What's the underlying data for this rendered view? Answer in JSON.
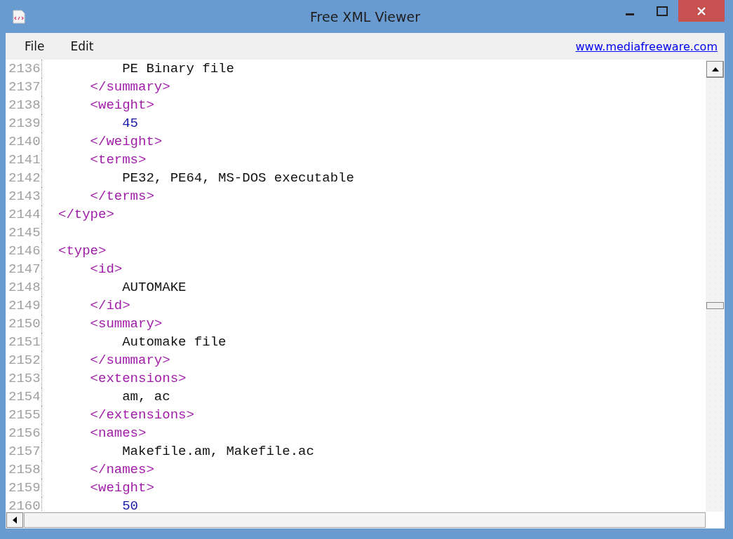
{
  "window": {
    "title": "Free XML Viewer"
  },
  "menu": [
    {
      "label": "File"
    },
    {
      "label": "Edit"
    }
  ],
  "link": "www.mediafreeware.com",
  "lines": [
    {
      "number": "2136",
      "kind": "text",
      "text": "        PE Binary file"
    },
    {
      "number": "2137",
      "kind": "tag",
      "text": "    </summary>"
    },
    {
      "number": "2138",
      "kind": "tag",
      "text": "    <weight>"
    },
    {
      "number": "2139",
      "kind": "number",
      "text": "        45"
    },
    {
      "number": "2140",
      "kind": "tag",
      "text": "    </weight>"
    },
    {
      "number": "2141",
      "kind": "tag",
      "text": "    <terms>"
    },
    {
      "number": "2142",
      "kind": "text",
      "text": "        PE32, PE64, MS-DOS executable"
    },
    {
      "number": "2143",
      "kind": "tag",
      "text": "    </terms>"
    },
    {
      "number": "2144",
      "kind": "tag",
      "text": "</type>"
    },
    {
      "number": "2145",
      "kind": "blank"
    },
    {
      "number": "2146",
      "kind": "tag",
      "text": "<type>"
    },
    {
      "number": "2147",
      "kind": "tag",
      "text": "    <id>"
    },
    {
      "number": "2148",
      "kind": "text",
      "text": "        AUTOMAKE"
    },
    {
      "number": "2149",
      "kind": "tag",
      "text": "    </id>"
    },
    {
      "number": "2150",
      "kind": "tag",
      "text": "    <summary>"
    },
    {
      "number": "2151",
      "kind": "text",
      "text": "        Automake file"
    },
    {
      "number": "2152",
      "kind": "tag",
      "text": "    </summary>"
    },
    {
      "number": "2153",
      "kind": "tag",
      "text": "    <extensions>"
    },
    {
      "number": "2154",
      "kind": "text",
      "text": "        am, ac"
    },
    {
      "number": "2155",
      "kind": "tag",
      "text": "    </extensions>"
    },
    {
      "number": "2156",
      "kind": "tag",
      "text": "    <names>"
    },
    {
      "number": "2157",
      "kind": "text",
      "text": "        Makefile.am, Makefile.ac"
    },
    {
      "number": "2158",
      "kind": "tag",
      "text": "    </names>"
    },
    {
      "number": "2159",
      "kind": "tag",
      "text": "    <weight>"
    },
    {
      "number": "2160",
      "kind": "number",
      "text": "        50"
    }
  ]
}
